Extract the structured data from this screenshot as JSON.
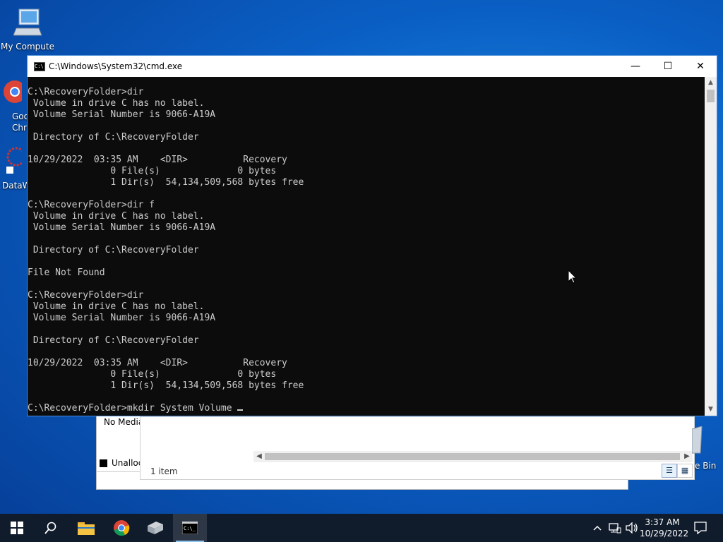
{
  "desktop": {
    "icons": [
      {
        "label": "My Computer"
      },
      {
        "label": "Goo\nChro"
      },
      {
        "label": "DataW"
      }
    ],
    "recycle_bin_label_partial": "e Bin"
  },
  "background_window": {
    "no_media_text": "No Media",
    "unallocated_text": "Unalloc"
  },
  "explorer": {
    "status_text": "1 item"
  },
  "cmd": {
    "title": "C:\\Windows\\System32\\cmd.exe",
    "controls": {
      "minimize": "—",
      "maximize": "☐",
      "close": "✕"
    },
    "lines": [
      "C:\\RecoveryFolder>dir",
      " Volume in drive C has no label.",
      " Volume Serial Number is 9066-A19A",
      "",
      " Directory of C:\\RecoveryFolder",
      "",
      "10/29/2022  03:35 AM    <DIR>          Recovery",
      "               0 File(s)              0 bytes",
      "               1 Dir(s)  54,134,509,568 bytes free",
      "",
      "C:\\RecoveryFolder>dir f",
      " Volume in drive C has no label.",
      " Volume Serial Number is 9066-A19A",
      "",
      " Directory of C:\\RecoveryFolder",
      "",
      "File Not Found",
      "",
      "C:\\RecoveryFolder>dir",
      " Volume in drive C has no label.",
      " Volume Serial Number is 9066-A19A",
      "",
      " Directory of C:\\RecoveryFolder",
      "",
      "10/29/2022  03:35 AM    <DIR>          Recovery",
      "               0 File(s)              0 bytes",
      "               1 Dir(s)  54,134,509,568 bytes free",
      ""
    ],
    "current_input": "C:\\RecoveryFolder>mkdir System Volume "
  },
  "taskbar": {
    "items": [
      "start-icon",
      "search-icon",
      "file-explorer-icon",
      "chrome-icon",
      "app-icon",
      "cmd-icon"
    ],
    "clock_time": "3:37 AM",
    "clock_date": "10/29/2022"
  },
  "colors": {
    "console_bg": "#0c0c0c",
    "console_text": "#cccccc",
    "taskbar_bg": "#101c2c",
    "desktop_accent": "#0a5fc4"
  }
}
